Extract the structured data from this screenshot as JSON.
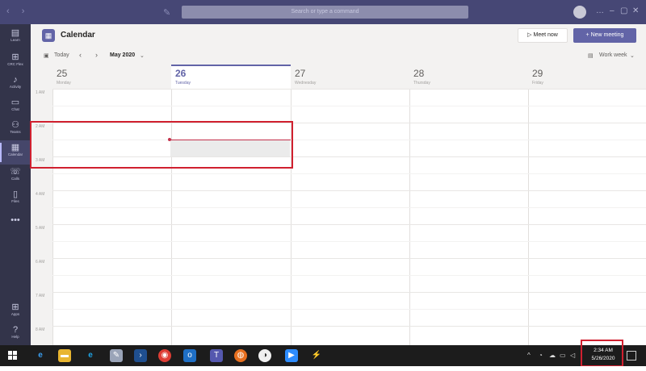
{
  "titlebar": {
    "search_placeholder": "Search or type a command"
  },
  "rail": {
    "items": [
      {
        "label": "Learn",
        "icon": "book-icon"
      },
      {
        "label": "CRC Flex",
        "icon": "apps-grid-icon"
      },
      {
        "label": "Activity",
        "icon": "bell-icon"
      },
      {
        "label": "Chat",
        "icon": "chat-icon"
      },
      {
        "label": "Teams",
        "icon": "teams-icon"
      },
      {
        "label": "Calendar",
        "icon": "calendar-icon"
      },
      {
        "label": "Calls",
        "icon": "phone-icon"
      },
      {
        "label": "Files",
        "icon": "file-icon"
      },
      {
        "label": "•••",
        "icon": "more-icon"
      }
    ],
    "bottom": [
      {
        "label": "Apps",
        "icon": "apps-icon"
      },
      {
        "label": "Help",
        "icon": "help-icon"
      }
    ]
  },
  "header": {
    "title": "Calendar",
    "meet_now": "Meet now",
    "new_meeting": "+ New meeting"
  },
  "toolbar": {
    "today": "Today",
    "month": "May 2020",
    "view": "Work week"
  },
  "calendar": {
    "days": [
      {
        "num": "25",
        "name": "Monday"
      },
      {
        "num": "26",
        "name": "Tuesday"
      },
      {
        "num": "27",
        "name": "Wednesday"
      },
      {
        "num": "28",
        "name": "Thursday"
      },
      {
        "num": "29",
        "name": "Friday"
      }
    ],
    "today_index": 1,
    "times": [
      "1 AM",
      "2 AM",
      "3 AM",
      "4 AM",
      "5 AM",
      "6 AM",
      "7 AM",
      "8 AM"
    ]
  },
  "taskbar": {
    "clock_time": "2:34 AM",
    "clock_date": "5/26/2020"
  },
  "colors": {
    "brand": "#6264a7",
    "titlebar": "#464775",
    "rail": "#33344a",
    "highlight": "#d0202f",
    "now_line": "#c4314b"
  }
}
